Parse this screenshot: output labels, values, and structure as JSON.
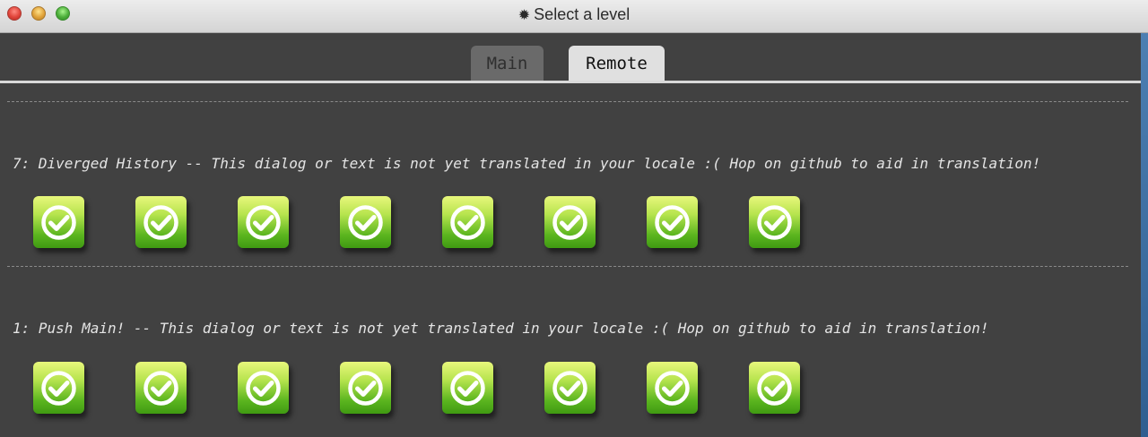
{
  "window": {
    "title": "Select a level",
    "title_icon": "gear-icon"
  },
  "tabs": [
    {
      "label": "Main",
      "active": false
    },
    {
      "label": "Remote",
      "active": true
    }
  ],
  "sections": [
    {
      "title": "7: Diverged History -- This dialog or text is not yet translated in your locale :( Hop on github to aid in translation!",
      "levels": [
        {
          "status": "completed",
          "icon": "check-circle-icon"
        },
        {
          "status": "completed",
          "icon": "check-circle-icon"
        },
        {
          "status": "completed",
          "icon": "check-circle-icon"
        },
        {
          "status": "completed",
          "icon": "check-circle-icon"
        },
        {
          "status": "completed",
          "icon": "check-circle-icon"
        },
        {
          "status": "completed",
          "icon": "check-circle-icon"
        },
        {
          "status": "completed",
          "icon": "check-circle-icon"
        },
        {
          "status": "completed",
          "icon": "check-circle-icon"
        }
      ]
    },
    {
      "title": "1: Push Main! -- This dialog or text is not yet translated in your locale :( Hop on github to aid in translation!",
      "levels": [
        {
          "status": "completed",
          "icon": "check-circle-icon"
        },
        {
          "status": "completed",
          "icon": "check-circle-icon"
        },
        {
          "status": "completed",
          "icon": "check-circle-icon"
        },
        {
          "status": "completed",
          "icon": "check-circle-icon"
        },
        {
          "status": "completed",
          "icon": "check-circle-icon"
        },
        {
          "status": "completed",
          "icon": "check-circle-icon"
        },
        {
          "status": "completed",
          "icon": "check-circle-icon"
        },
        {
          "status": "completed",
          "icon": "check-circle-icon"
        }
      ]
    }
  ],
  "colors": {
    "background": "#414141",
    "level_complete": "#5bb51f"
  }
}
